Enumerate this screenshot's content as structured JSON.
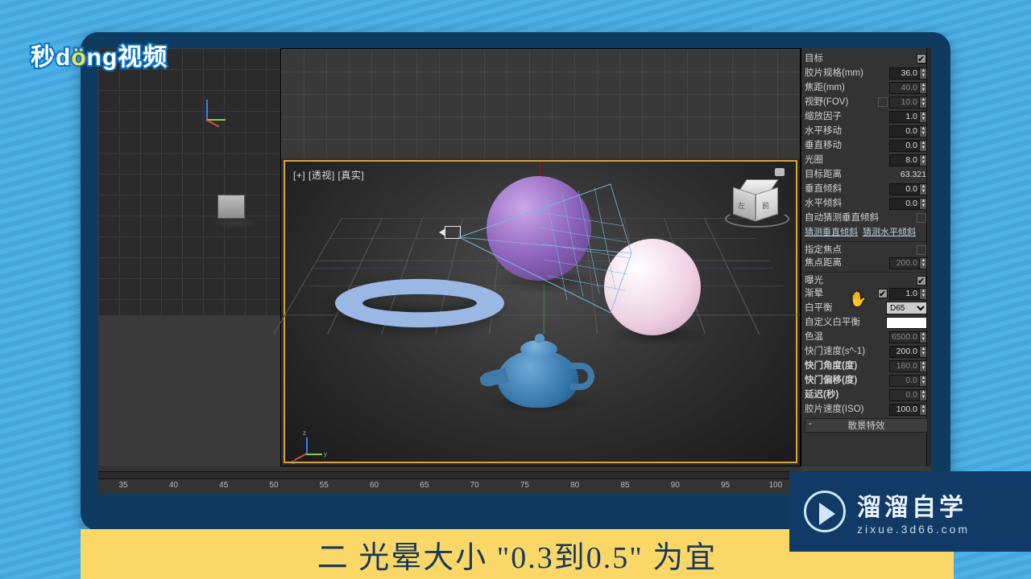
{
  "brand_text": "秒d▶ng视频",
  "viewport": {
    "label": "[+] [透视] [真实]",
    "y_label": "y"
  },
  "navcube": {
    "left": "左",
    "right": "前"
  },
  "panel": {
    "target_label": "目标",
    "film_label": "胶片规格(mm)",
    "film_val": "36.0",
    "focal_label": "焦距(mm)",
    "focal_val": "40.0",
    "fov_label": "视野(FOV)",
    "fov_val": "10.0",
    "zoom_label": "缩放因子",
    "zoom_val": "1.0",
    "hshift_label": "水平移动",
    "hshift_val": "0.0",
    "vshift_label": "垂直移动",
    "vshift_val": "0.0",
    "fnum_label": "光圈",
    "fnum_val": "8.0",
    "tdist_label": "目标距离",
    "tdist_val": "63.321",
    "vtilt_label": "垂直倾斜",
    "vtilt_val": "0.0",
    "htilt_label": "水平倾斜",
    "htilt_val": "0.0",
    "auto_tilt_label": "自动猜测垂直倾斜",
    "guess_v": "猜测垂直倾斜",
    "guess_h": "猜测水平倾斜",
    "spec_focus_label": "指定焦点",
    "focus_dist_label": "焦点距离",
    "focus_dist_val": "200.0",
    "exposure_label": "曝光",
    "vignette_label": "渐晕",
    "vignette_val": "1.0",
    "wb_label": "白平衡",
    "wb_val": "D65",
    "custom_wb_label": "自定义白平衡",
    "temp_label": "色温",
    "temp_val": "6500.0",
    "shutter_spd_label": "快门速度(s^-1)",
    "shutter_spd_val": "200.0",
    "shutter_ang_label": "快门角度(度)",
    "shutter_ang_val": "180.0",
    "shutter_off_label": "快门偏移(度)",
    "shutter_off_val": "0.0",
    "delay_label": "延迟(秒)",
    "delay_val": "0.0",
    "iso_label": "胶片速度(ISO)",
    "iso_val": "100.0",
    "rollout": "散景特效"
  },
  "ruler": {
    "t": [
      "35",
      "40",
      "45",
      "50",
      "55",
      "60",
      "65",
      "70",
      "75",
      "80",
      "85",
      "90",
      "95",
      "100"
    ]
  },
  "caption": "二 光晕大小 \"0.3到0.5\" 为宜",
  "site": {
    "cn": "溜溜自学",
    "en": "zixue.3d66.com"
  }
}
